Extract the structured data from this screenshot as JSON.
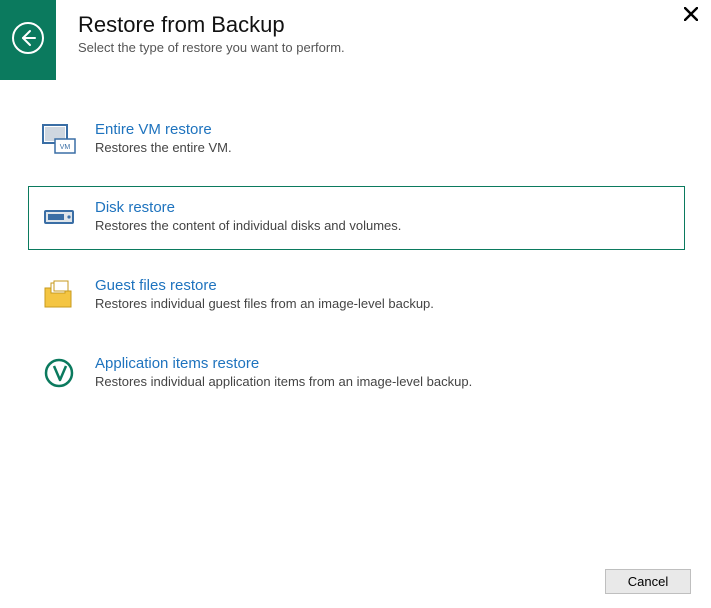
{
  "header": {
    "title": "Restore from Backup",
    "subtitle": "Select the type of restore you want to perform."
  },
  "options": [
    {
      "id": "entire-vm",
      "title": "Entire VM restore",
      "desc": "Restores the entire VM.",
      "selected": false
    },
    {
      "id": "disk",
      "title": "Disk restore",
      "desc": "Restores the content of individual disks and volumes.",
      "selected": true
    },
    {
      "id": "guest-files",
      "title": "Guest files restore",
      "desc": "Restores individual guest files from an image-level backup.",
      "selected": false
    },
    {
      "id": "application-items",
      "title": "Application items restore",
      "desc": "Restores individual application items from an image-level backup.",
      "selected": false
    }
  ],
  "footer": {
    "cancel": "Cancel"
  },
  "colors": {
    "accent": "#0b7a5e",
    "link": "#1e73be"
  }
}
